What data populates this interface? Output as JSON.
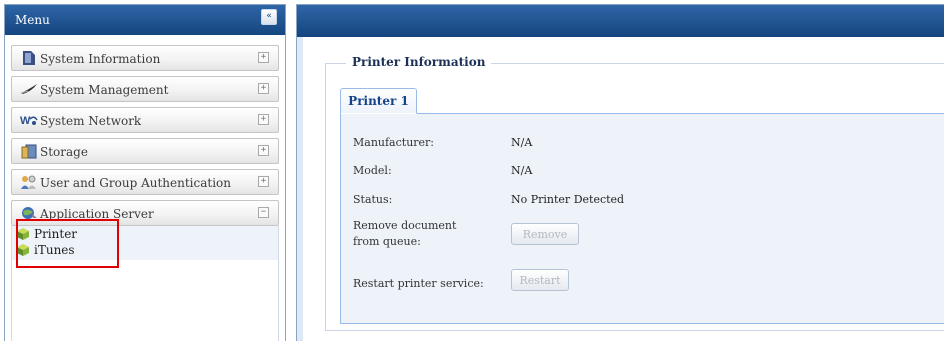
{
  "menu": {
    "title": "Menu",
    "collapse_icon": "«",
    "items": [
      {
        "label": "System Information",
        "icon": "book-icon",
        "toggle": "+"
      },
      {
        "label": "System Management",
        "icon": "feather-icon",
        "toggle": "+"
      },
      {
        "label": "System Network",
        "icon": "network-icon",
        "toggle": "+"
      },
      {
        "label": "Storage",
        "icon": "storage-icon",
        "toggle": "+"
      },
      {
        "label": "User and Group Authentication",
        "icon": "users-icon",
        "toggle": "+"
      },
      {
        "label": "Application Server",
        "icon": "globe-icon",
        "toggle": "−"
      }
    ],
    "sub_items": [
      {
        "label": "Printer",
        "icon": "cube-icon"
      },
      {
        "label": "iTunes",
        "icon": "cube-icon"
      }
    ]
  },
  "content": {
    "section_title": "Printer Information",
    "tabs": [
      {
        "label": "Printer 1"
      }
    ],
    "fields": {
      "manufacturer_label": "Manufacturer:",
      "manufacturer_value": "N/A",
      "model_label": "Model:",
      "model_value": "N/A",
      "status_label": "Status:",
      "status_value": "No Printer Detected",
      "remove_label_line1": "Remove document",
      "remove_label_line2": "from queue:",
      "remove_button": "Remove",
      "restart_label": "Restart printer service:",
      "restart_button": "Restart"
    }
  },
  "colors": {
    "header_blue": "#14457f",
    "highlight_red": "#e00000",
    "tab_text": "#15428b"
  }
}
